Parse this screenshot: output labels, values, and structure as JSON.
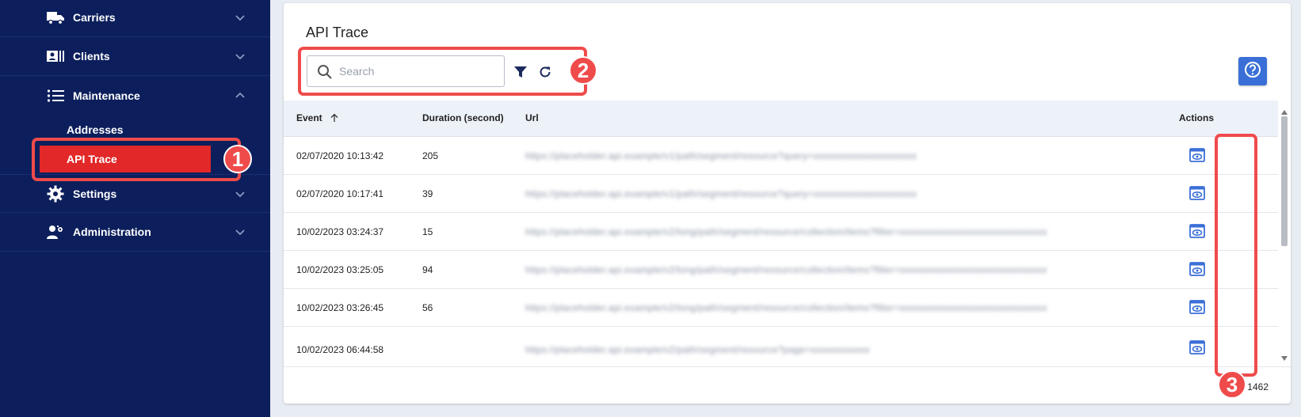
{
  "sidebar": {
    "items": [
      {
        "label": "Carriers",
        "icon": "truck-icon",
        "expanded": false
      },
      {
        "label": "Clients",
        "icon": "contact-card-icon",
        "expanded": false
      },
      {
        "label": "Maintenance",
        "icon": "list-icon",
        "expanded": true
      },
      {
        "label": "Settings",
        "icon": "gear-icon",
        "expanded": false
      },
      {
        "label": "Administration",
        "icon": "admin-users-icon",
        "expanded": false
      }
    ],
    "sub_items": [
      {
        "label": "Addresses",
        "active": false
      },
      {
        "label": "API Trace",
        "active": true
      }
    ]
  },
  "main": {
    "title": "API Trace",
    "search_placeholder": "Search",
    "table": {
      "columns": {
        "event": "Event",
        "duration": "Duration (second)",
        "url": "Url",
        "actions": "Actions"
      },
      "rows": [
        {
          "event": "02/07/2020 10:13:42",
          "duration": "205",
          "url": "https://placeholder.api.example/v1/path/segment/resource?query=xxxxxxxxxxxxxxxxxxxxx"
        },
        {
          "event": "02/07/2020 10:17:41",
          "duration": "39",
          "url": "https://placeholder.api.example/v1/path/segment/resource?query=xxxxxxxxxxxxxxxxxxxxx"
        },
        {
          "event": "10/02/2023 03:24:37",
          "duration": "15",
          "url": "https://placeholder.api.example/v2/long/path/segment/resource/collection/items?filter=xxxxxxxxxxxxxxxxxxxxxxxxxxxxxx"
        },
        {
          "event": "10/02/2023 03:25:05",
          "duration": "94",
          "url": "https://placeholder.api.example/v2/long/path/segment/resource/collection/items?filter=xxxxxxxxxxxxxxxxxxxxxxxxxxxxxx"
        },
        {
          "event": "10/02/2023 03:26:45",
          "duration": "56",
          "url": "https://placeholder.api.example/v2/long/path/segment/resource/collection/items?filter=xxxxxxxxxxxxxxxxxxxxxxxxxxxxxx"
        },
        {
          "event": "10/02/2023 06:44:58",
          "duration": "",
          "url": "https://placeholder.api.example/v2/path/segment/resource?page=xxxxxxxxxxxx"
        }
      ]
    },
    "footer_count": "1462"
  },
  "annotations": [
    "1",
    "2",
    "3"
  ],
  "colors": {
    "sidebar_bg": "#0c1f5c",
    "active_item": "#e22828",
    "accent_blue": "#3b6fd8",
    "callout_red": "#ef4b4b"
  }
}
